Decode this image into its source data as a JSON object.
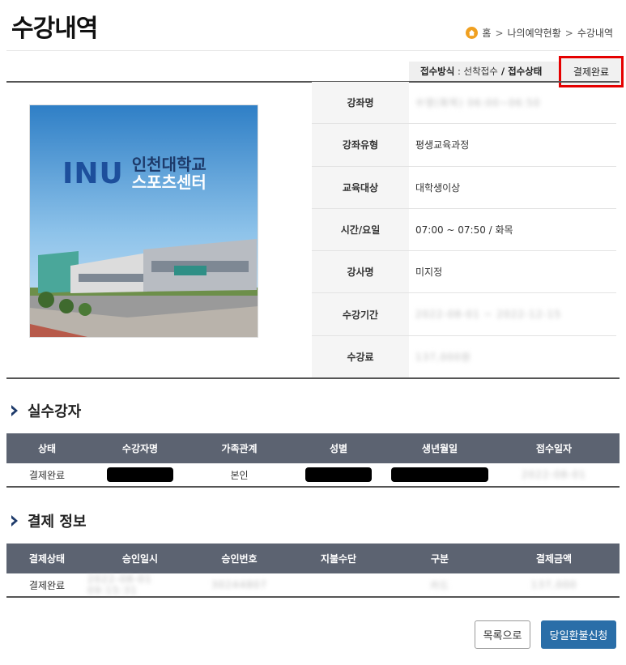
{
  "page": {
    "title": "수강내역"
  },
  "breadcrumb": {
    "items": [
      "홈",
      "나의예약현황",
      "수강내역"
    ],
    "separator": ">"
  },
  "status_bar": {
    "method_label": "접수방식",
    "method_value": "선착접수",
    "status_label": "접수상태",
    "status_value": "결제완료"
  },
  "course_image": {
    "logo_letters": "INU",
    "logo_line1": "인천대학교",
    "logo_line2": "스포츠센터"
  },
  "details": [
    {
      "label": "강좌명",
      "value": "수영(화목) 06:00~06:50",
      "blurred": true
    },
    {
      "label": "강좌유형",
      "value": "평생교육과정",
      "blurred": false
    },
    {
      "label": "교육대상",
      "value": "대학생이상",
      "blurred": false
    },
    {
      "label": "시간/요일",
      "value": "07:00 ~ 07:50 / 화목",
      "blurred": false
    },
    {
      "label": "강사명",
      "value": "미지정",
      "blurred": false
    },
    {
      "label": "수강기간",
      "value": "2022-08-01 ~ 2022-12-15",
      "blurred": true
    },
    {
      "label": "수강료",
      "value": "137,000원",
      "blurred": true
    }
  ],
  "attendees": {
    "title": "실수강자",
    "headers": [
      "상태",
      "수강자명",
      "가족관계",
      "성별",
      "생년월일",
      "접수일자"
    ],
    "row": {
      "status": "결제완료",
      "relation": "본인",
      "reg_date": "2022-08-01"
    }
  },
  "payment": {
    "title": "결제 정보",
    "headers": [
      "결제상태",
      "승인일시",
      "승인번호",
      "지불수단",
      "구분",
      "결제금액"
    ],
    "row": {
      "status": "결제완료",
      "approved_at": "2022-08-01 09:15:31",
      "approval_no": "30244807",
      "method": "",
      "type": "카드",
      "amount": "137,000"
    }
  },
  "buttons": {
    "list": "목록으로",
    "refund": "당일환불신청"
  },
  "colors": {
    "table_header": "#5c6371",
    "refund_button": "#2a6ea8",
    "highlight": "#e50000",
    "home_icon": "#f0a020"
  }
}
